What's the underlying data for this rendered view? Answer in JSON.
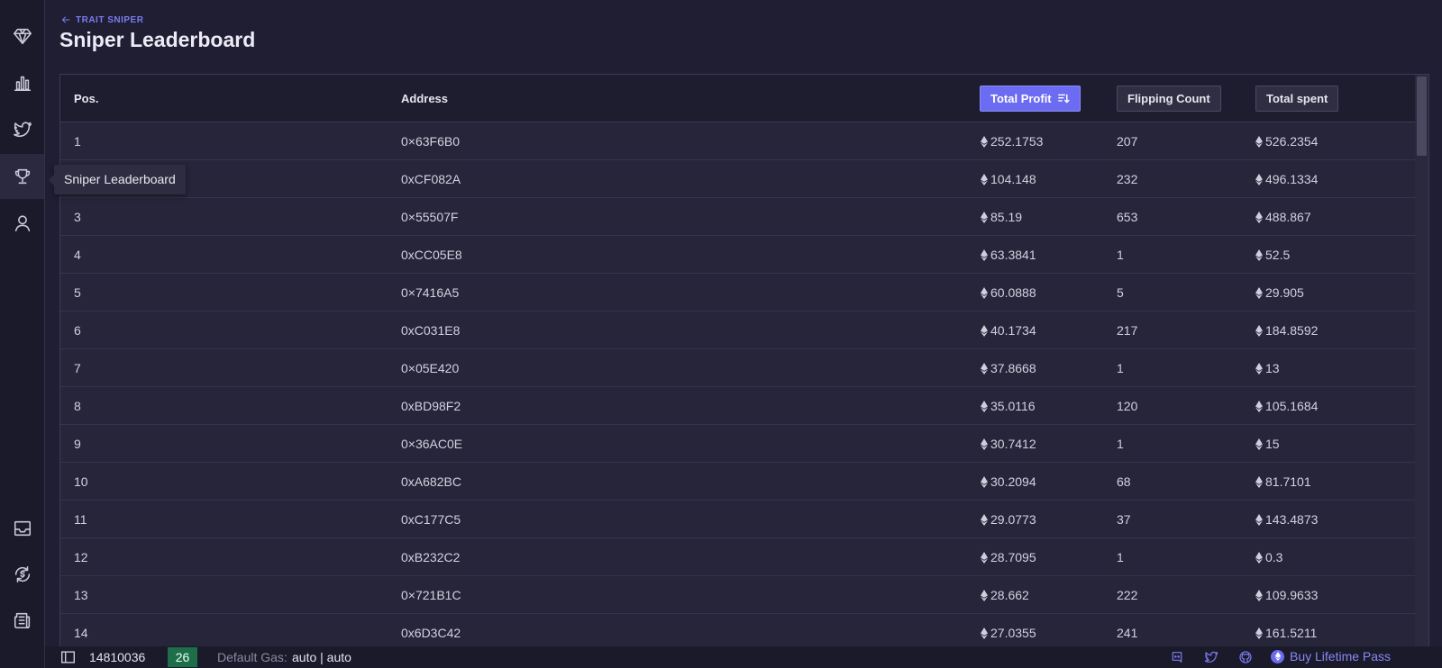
{
  "breadcrumb": {
    "label": "TRAIT SNIPER"
  },
  "page": {
    "title": "Sniper Leaderboard"
  },
  "sidebar": {
    "tooltip": "Sniper Leaderboard",
    "items": [
      {
        "icon": "diamond-icon"
      },
      {
        "icon": "bar-chart-icon"
      },
      {
        "icon": "twitter-icon"
      },
      {
        "icon": "trophy-icon",
        "active": true
      },
      {
        "icon": "user-icon"
      },
      {
        "icon": "inbox-icon"
      },
      {
        "icon": "sync-dollar-icon"
      },
      {
        "icon": "newspaper-icon"
      }
    ]
  },
  "table": {
    "columns": {
      "pos": "Pos.",
      "address": "Address",
      "total_profit": "Total Profit",
      "flipping_count": "Flipping Count",
      "total_spent": "Total spent"
    },
    "sorted_by": "total_profit",
    "rows": [
      {
        "pos": "1",
        "address": "0×63F6B0",
        "profit": "252.1753",
        "flips": "207",
        "spent": "526.2354"
      },
      {
        "pos": "2",
        "address": "0xCF082A",
        "profit": "104.148",
        "flips": "232",
        "spent": "496.1334"
      },
      {
        "pos": "3",
        "address": "0×55507F",
        "profit": "85.19",
        "flips": "653",
        "spent": "488.867"
      },
      {
        "pos": "4",
        "address": "0xCC05E8",
        "profit": "63.3841",
        "flips": "1",
        "spent": "52.5"
      },
      {
        "pos": "5",
        "address": "0×7416A5",
        "profit": "60.0888",
        "flips": "5",
        "spent": "29.905"
      },
      {
        "pos": "6",
        "address": "0xC031E8",
        "profit": "40.1734",
        "flips": "217",
        "spent": "184.8592"
      },
      {
        "pos": "7",
        "address": "0×05E420",
        "profit": "37.8668",
        "flips": "1",
        "spent": "13"
      },
      {
        "pos": "8",
        "address": "0xBD98F2",
        "profit": "35.0116",
        "flips": "120",
        "spent": "105.1684"
      },
      {
        "pos": "9",
        "address": "0×36AC0E",
        "profit": "30.7412",
        "flips": "1",
        "spent": "15"
      },
      {
        "pos": "10",
        "address": "0xA682BC",
        "profit": "30.2094",
        "flips": "68",
        "spent": "81.7101"
      },
      {
        "pos": "11",
        "address": "0xC177C5",
        "profit": "29.0773",
        "flips": "37",
        "spent": "143.4873"
      },
      {
        "pos": "12",
        "address": "0xB232C2",
        "profit": "28.7095",
        "flips": "1",
        "spent": "0.3"
      },
      {
        "pos": "13",
        "address": "0×721B1C",
        "profit": "28.662",
        "flips": "222",
        "spent": "109.9633"
      },
      {
        "pos": "14",
        "address": "0x6D3C42",
        "profit": "27.0355",
        "flips": "241",
        "spent": "161.5211"
      }
    ]
  },
  "footer": {
    "block_number": "14810036",
    "gas_badge": "26",
    "gas_label": "Default Gas:",
    "gas_value": "auto | auto",
    "buy_label": "Buy Lifetime Pass",
    "icons": [
      "discord-icon",
      "twitter-icon",
      "github-icon"
    ]
  },
  "colors": {
    "accent": "#6b6cf1",
    "background": "#201e32",
    "sidebar": "#1b1a2b",
    "badge_green": "#1f6e4a"
  }
}
